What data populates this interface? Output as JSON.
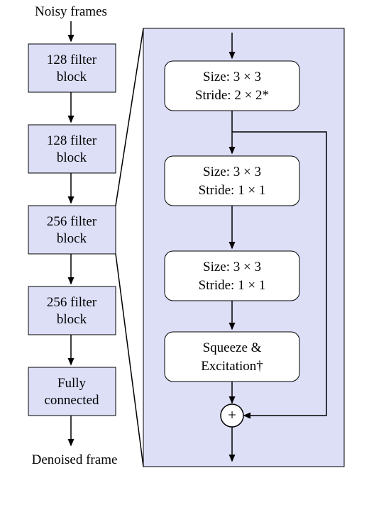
{
  "chart_data": {
    "type": "diagram",
    "title": "Noisy frames to Denoised frame network architecture",
    "left_pipeline": [
      "128 filter block",
      "128 filter block",
      "256 filter block",
      "256 filter block",
      "Fully connected"
    ],
    "right_expansion": [
      {
        "size": "3 × 3",
        "stride": "2 × 2*"
      },
      {
        "size": "3 × 3",
        "stride": "1 × 1"
      },
      {
        "size": "3 × 3",
        "stride": "1 × 1"
      },
      {
        "se": "Squeeze & Excitation†"
      }
    ],
    "residual_add": "+"
  },
  "labels": {
    "input": "Noisy frames",
    "output": "Denoised frame",
    "block128_l1": "128 filter",
    "block128_l2": "block",
    "block256_l1": "256 filter",
    "block256_l2": "block",
    "fc_l1": "Fully",
    "fc_l2": "connected",
    "size": "Size: 3 × 3",
    "stride22": "Stride: 2 × 2*",
    "stride11": "Stride: 1 × 1",
    "se_l1": "Squeeze &",
    "se_l2": "Excitation†",
    "plus": "+"
  }
}
